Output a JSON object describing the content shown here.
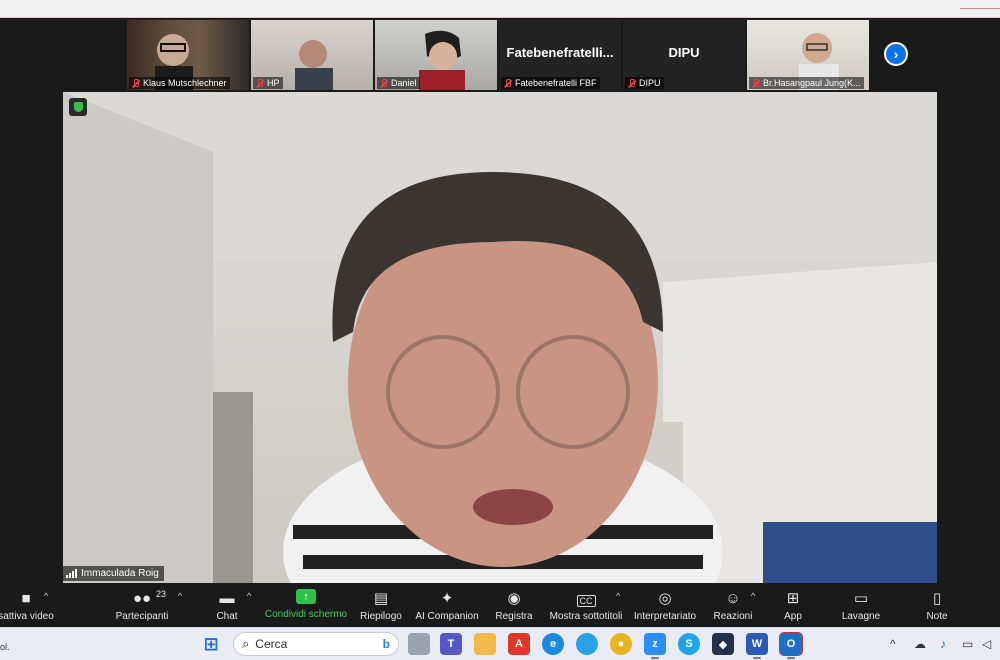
{
  "thumbnails": [
    {
      "name": "Klaus Mutschlechner",
      "big": "",
      "muted": true
    },
    {
      "name": "HP",
      "big": "",
      "muted": true
    },
    {
      "name": "Daniel",
      "big": "",
      "muted": true
    },
    {
      "name": "Fatebenefratelli FBF",
      "big": "Fatebenefratelli...",
      "muted": true
    },
    {
      "name": "DIPU",
      "big": "DIPU",
      "muted": true
    },
    {
      "name": "Br.Hasangpaul Jung(K...",
      "big": "",
      "muted": true
    }
  ],
  "next_icon": "chevron-right-icon",
  "main": {
    "speaker_name": "Immaculada Roig",
    "encryption_icon": "shield-icon"
  },
  "toolbar": {
    "video_label": "sattiva video",
    "participants_label": "Partecipanti",
    "participants_count": "23",
    "chat_label": "Chat",
    "share_label": "Condividi schermo",
    "summary_label": "Riepilogo",
    "ai_label": "AI Companion",
    "record_label": "Registra",
    "captions_label": "Mostra sottotitoli",
    "captions_icon_text": "CC",
    "interpret_label": "Interpretariato",
    "reactions_label": "Reazioni",
    "apps_label": "App",
    "whiteboard_label": "Lavagne",
    "notes_label": "Note"
  },
  "taskbar": {
    "left_fragment": "ol.",
    "search_placeholder": "Cerca",
    "apps": [
      "windows-start-icon",
      "files-icon",
      "teams-icon",
      "file-explorer-icon",
      "acrobat-icon",
      "edge-icon",
      "store-icon",
      "chrome-icon",
      "zoom-icon",
      "skype-icon",
      "app-icon",
      "word-icon",
      "outlook-icon"
    ]
  },
  "colors": {
    "zoom_bg": "#1a1a1a",
    "share_green": "#2fc24a",
    "accent_blue": "#0e72ed",
    "muted_red": "#e64040"
  }
}
